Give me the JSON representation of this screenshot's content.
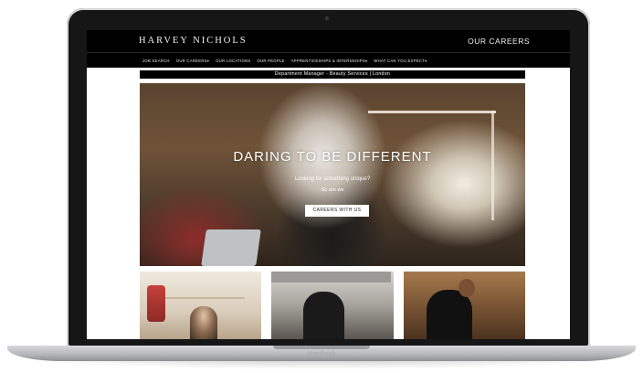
{
  "site": {
    "logo": "HARVEY NICHOLS",
    "careers_title": "OUR CAREERS"
  },
  "nav": {
    "items": [
      {
        "label": "JOB SEARCH"
      },
      {
        "label": "OUR CAREERS▾"
      },
      {
        "label": "OUR LOCATIONS"
      },
      {
        "label": "OUR PEOPLE"
      },
      {
        "label": "APPRENTICESHIPS & INTERNSHIPS▾"
      },
      {
        "label": "WHAT CAN YOU EXPECT▾"
      }
    ]
  },
  "banner": {
    "text": "Department Manager - Beauty Services | London"
  },
  "hero": {
    "title": "DARING TO BE DIFFERENT",
    "subtitle": "Looking for something unique?",
    "subtitle2": "So are we",
    "button_label": "CAREERS WITH US"
  },
  "device": {
    "label": "MacBook"
  }
}
